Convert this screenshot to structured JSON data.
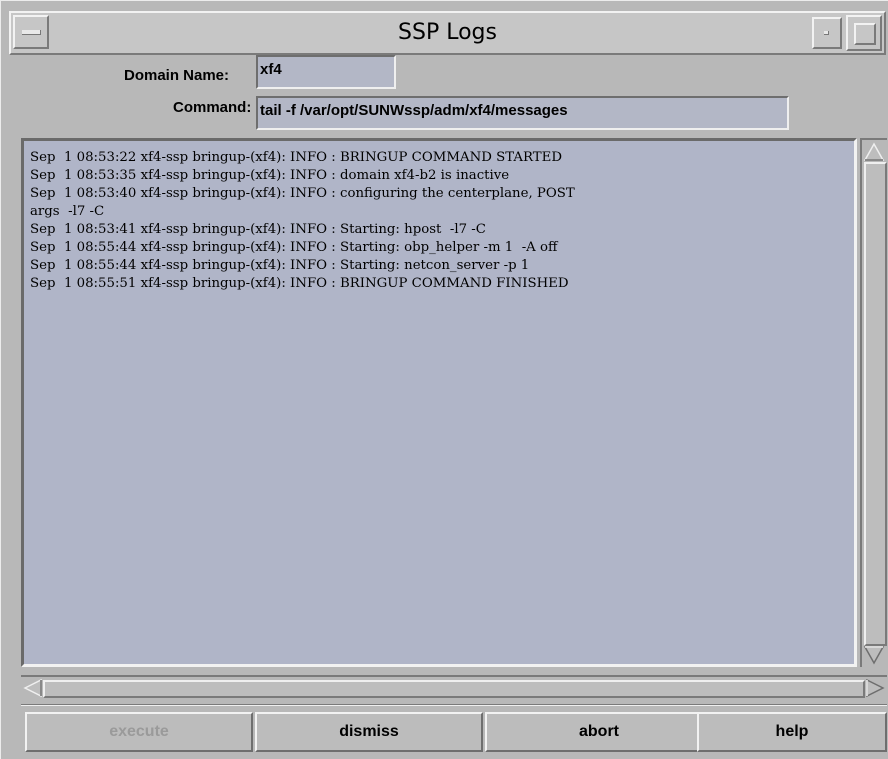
{
  "window": {
    "title": "SSP Logs"
  },
  "form": {
    "domain_label": "Domain Name:",
    "domain_value": "xf4",
    "command_label": "Command:",
    "command_value": "tail -f /var/opt/SUNWssp/adm/xf4/messages"
  },
  "log": {
    "lines": [
      "Sep  1 08:53:22 xf4-ssp bringup-(xf4): INFO : BRINGUP COMMAND STARTED",
      "Sep  1 08:53:35 xf4-ssp bringup-(xf4): INFO : domain xf4-b2 is inactive",
      "Sep  1 08:53:40 xf4-ssp bringup-(xf4): INFO : configuring the centerplane, POST",
      "args  -l7 -C",
      "Sep  1 08:53:41 xf4-ssp bringup-(xf4): INFO : Starting: hpost  -l7 -C",
      "Sep  1 08:55:44 xf4-ssp bringup-(xf4): INFO : Starting: obp_helper -m 1  -A off",
      "Sep  1 08:55:44 xf4-ssp bringup-(xf4): INFO : Starting: netcon_server -p 1",
      "Sep  1 08:55:51 xf4-ssp bringup-(xf4): INFO : BRINGUP COMMAND FINISHED"
    ]
  },
  "buttons": {
    "execute": "execute",
    "dismiss": "dismiss",
    "abort": "abort",
    "help": "help"
  },
  "icons": {
    "window_menu": "window-menu-icon",
    "minimize": "minimize-icon",
    "maximize": "maximize-icon",
    "scroll_up": "triangle-up-icon",
    "scroll_down": "triangle-down-icon",
    "scroll_left": "triangle-left-icon",
    "scroll_right": "triangle-right-icon"
  }
}
